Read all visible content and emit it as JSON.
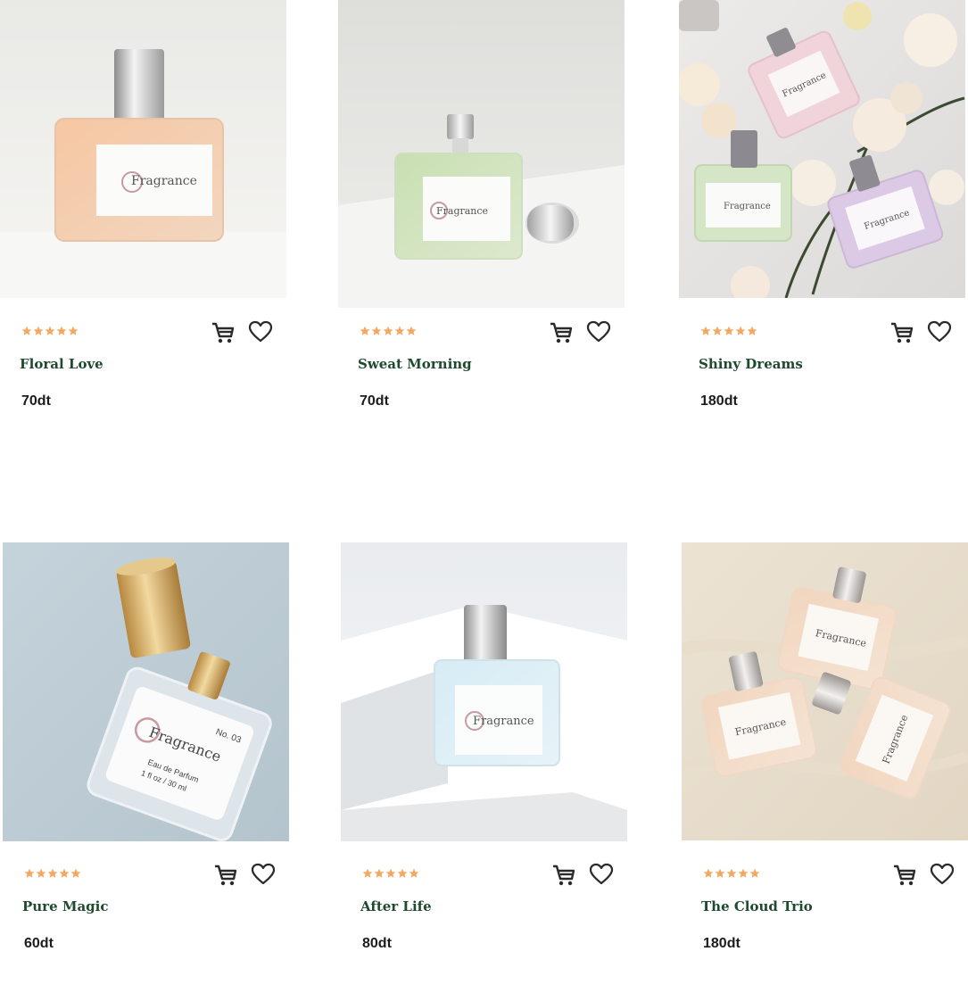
{
  "colors": {
    "star": "#f4a862",
    "product_name": "#1f4a2e",
    "price": "#1c1c1c",
    "icon": "#2a2a2a"
  },
  "icons": {
    "rating": "star-icon",
    "cart": "cart-icon",
    "wishlist": "heart-icon"
  },
  "products": [
    {
      "name": "Floral Love",
      "price": "70dt",
      "rating": 5,
      "label_brand": "Fragrance"
    },
    {
      "name": "Sweat Morning",
      "price": "70dt",
      "rating": 5,
      "label_brand": "Fragrance"
    },
    {
      "name": "Shiny Dreams",
      "price": "180dt",
      "rating": 5,
      "label_brand": "Fragrance"
    },
    {
      "name": "Pure Magic",
      "price": "60dt",
      "rating": 5,
      "label_brand": "Fragrance",
      "label_number": "No. 03",
      "label_type": "Eau de Parfum",
      "label_volume": "1 fl oz / 30 ml"
    },
    {
      "name": "After Life",
      "price": "80dt",
      "rating": 5,
      "label_brand": "Fragrance"
    },
    {
      "name": "The Cloud Trio",
      "price": "180dt",
      "rating": 5,
      "label_brand": "Fragrance"
    }
  ]
}
